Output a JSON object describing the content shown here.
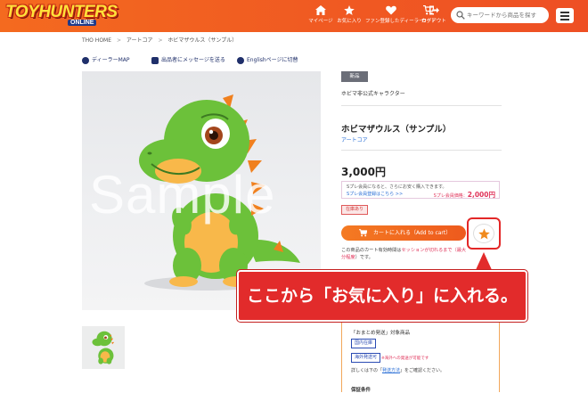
{
  "header": {
    "logo_main": "TOYHUNTERS",
    "logo_sub": "ONLINE",
    "nav": [
      {
        "label": "マイページ",
        "icon": "home-icon"
      },
      {
        "label": "お気に入り",
        "icon": "star-icon"
      },
      {
        "label": "ファン登録したディーラー",
        "icon": "heart-icon"
      },
      {
        "label": "カート",
        "icon": "cart-icon"
      },
      {
        "label": "ログアウト",
        "icon": "logout-icon"
      }
    ],
    "search_placeholder": "キーワードから商品を探す"
  },
  "breadcrumb": [
    "THO HOME",
    ">",
    "アートコア",
    ">",
    "ホビマザウルス（サンプル）"
  ],
  "utilities": [
    "ディーラーMAP",
    "出品者にメッセージを送る",
    "Englishページに切替"
  ],
  "product": {
    "watermark": "Sample",
    "badge": "新品",
    "unofficial": "ホビマ非公式キャラクター",
    "name": "ホビマザウルス（サンプル）",
    "maker": "アートコア",
    "price": "3,000円",
    "member_note": "Sプレ会員になると、さらにお安く購入できます。",
    "member_link": "Sプレ会員登録はこちら >>",
    "member_price_label": "Sプレ会員価格：",
    "member_price": "2,000円",
    "stock": "在庫あり",
    "cart_label": "カートに入れる（Add to cart）",
    "cart_note_prefix": "この商品のカート有効時間は",
    "cart_note_red": "セッションが切れるまで（最大",
    "cart_note_suffix": "分程度",
    "cart_note_end": "）です。"
  },
  "callout": {
    "text": "ここから「お気に入り」に入れる。"
  },
  "shipping": {
    "title": "「おまとめ発送」対象商品",
    "tags": [
      "国内在庫",
      "海外発送可"
    ],
    "note": "※海外への発送が可能です",
    "detail_prefix": "詳しくは下の「",
    "detail_link": "発送方法",
    "detail_suffix": "」をご確認ください。",
    "warranty": "保証条件"
  },
  "colors": {
    "header_orange": "#f05a22",
    "accent_red": "#e22b2b",
    "link_blue": "#2a6fd6",
    "navy": "#1f2f6a"
  }
}
